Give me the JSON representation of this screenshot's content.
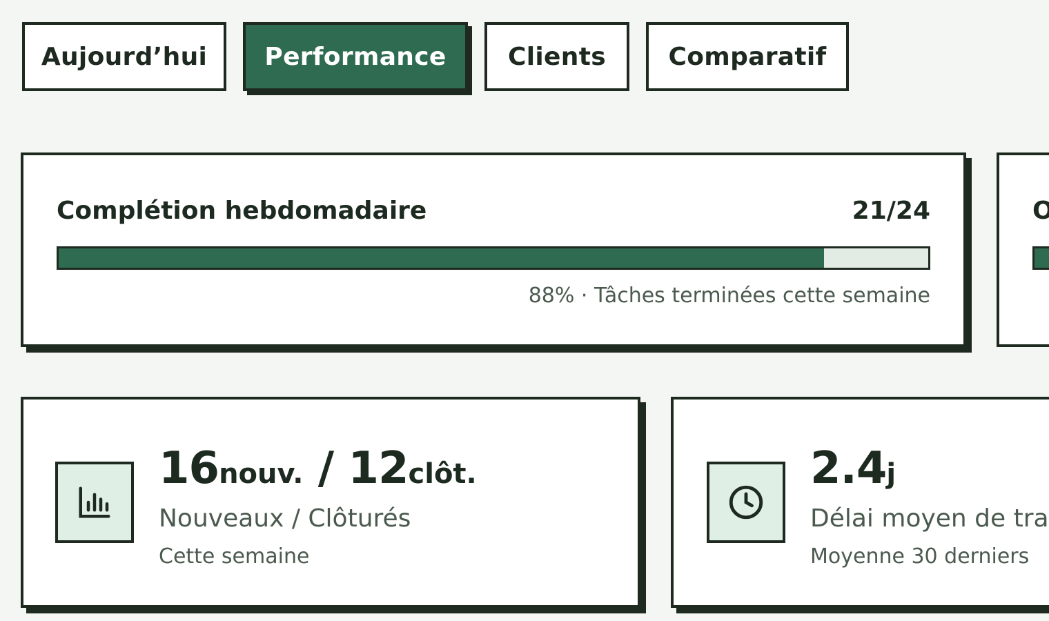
{
  "tabs": [
    {
      "label": "Aujourd’hui",
      "active": false
    },
    {
      "label": "Performance",
      "active": true
    },
    {
      "label": "Clients",
      "active": false
    },
    {
      "label": "Comparatif",
      "active": false
    }
  ],
  "completion": {
    "title": "Complétion hebdomadaire",
    "count": "21/24",
    "progress_percent": 88,
    "caption": "88% · Tâches terminées cette semaine"
  },
  "partial_card": {
    "title_fragment": "O",
    "progress_percent": 100
  },
  "tickets_card": {
    "icon": "bar-chart-icon",
    "new_value": "16",
    "new_unit": "nouv.",
    "separator": " / ",
    "closed_value": "12",
    "closed_unit": "clôt.",
    "label": "Nouveaux / Clôturés",
    "sublabel": "Cette semaine"
  },
  "delay_card": {
    "icon": "clock-icon",
    "value": "2.4",
    "unit": "j",
    "label": "Délai moyen de tra",
    "sublabel": "Moyenne 30 derniers"
  },
  "colors": {
    "accent": "#2e6b50",
    "border": "#1e2a1f",
    "background": "#f4f6f3",
    "track": "#e3ebe5",
    "icon_bg": "#e0efe6"
  }
}
